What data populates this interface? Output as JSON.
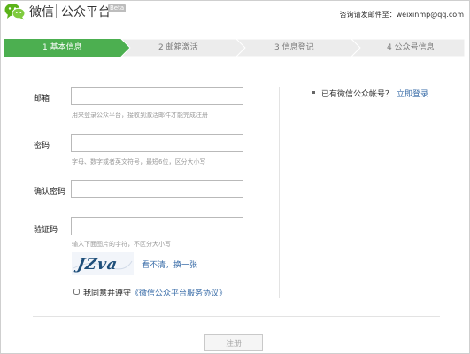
{
  "header": {
    "brand": "微信",
    "product": "公众平台",
    "badge": "Beta",
    "consult": "咨询请发邮件至：weixinmp@qq.com"
  },
  "steps": [
    {
      "label": "1 基本信息",
      "active": true
    },
    {
      "label": "2 邮箱激活",
      "active": false
    },
    {
      "label": "3 信息登记",
      "active": false
    },
    {
      "label": "4 公众号信息",
      "active": false
    }
  ],
  "colors": {
    "active_step": "#4caf50",
    "inactive_step": "#ececec",
    "link": "#3a6da8"
  },
  "form": {
    "email": {
      "label": "邮箱",
      "value": "",
      "hint": "用来登录公众平台，接收到激活邮件才能完成注册"
    },
    "password": {
      "label": "密码",
      "value": "",
      "hint": "字母、数字或者英文符号，最短6位，区分大小写"
    },
    "confirm": {
      "label": "确认密码",
      "value": ""
    },
    "captcha": {
      "label": "验证码",
      "value": "",
      "hint": "输入下面图片的字符，不区分大小写",
      "image_text": "JZva",
      "refresh": "看不清，换一张"
    },
    "agree": {
      "prefix": "我同意并遵守",
      "link": "《微信公众平台服务协议》",
      "checked": false
    }
  },
  "login": {
    "question": "已有微信公众帐号？",
    "link": "立即登录"
  },
  "register_label": "注册"
}
